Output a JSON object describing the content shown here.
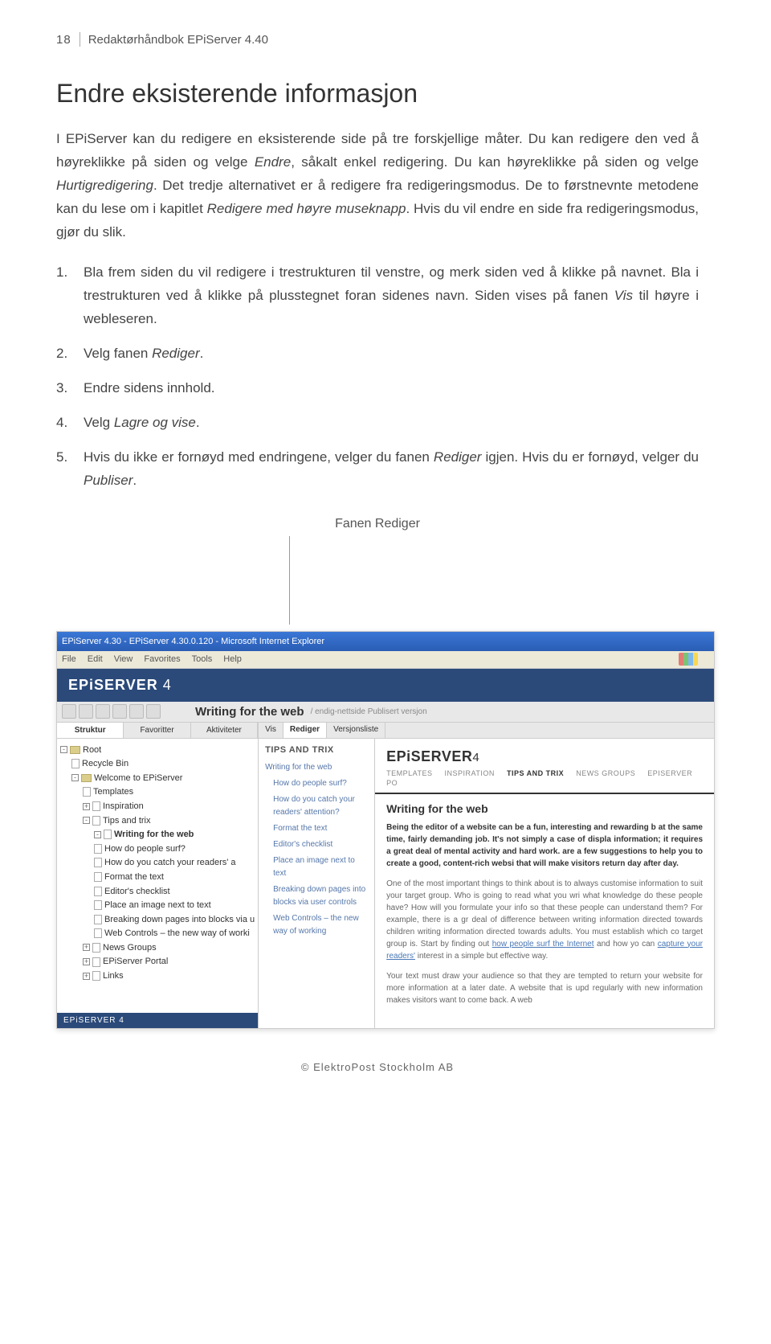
{
  "header": {
    "page_num": "18",
    "title": "Redaktørhåndbok EPiServer 4.40"
  },
  "section_title": "Endre eksisterende informasjon",
  "para1_a": "I EPiServer kan du redigere en eksisterende side på tre forskjellige måter. Du kan redigere den ved å høyreklikke på siden og velge ",
  "para1_b": "Endre",
  "para1_c": ", såkalt enkel redigering. Du kan høyreklikke på siden og velge ",
  "para1_d": "Hurtigredigering",
  "para1_e": ". Det tredje alternativet er å redigere fra redigeringsmodus. De to førstnevnte metodene kan du lese om i kapitlet ",
  "para1_f": "Redigere med høyre museknapp",
  "para1_g": ". Hvis du vil endre en side fra redigeringsmodus, gjør du slik.",
  "steps": [
    {
      "n": "1.",
      "t": "Bla frem siden du vil redigere i trestrukturen til venstre, og merk siden ved å klikke på navnet. Bla i trestrukturen ved å klikke på plusstegnet foran sidenes navn. Siden vises på fanen <em>Vis</em> til høyre i webleseren."
    },
    {
      "n": "2.",
      "t": "Velg fanen <em>Rediger</em>."
    },
    {
      "n": "3.",
      "t": "Endre sidens innhold."
    },
    {
      "n": "4.",
      "t": "Velg <em>Lagre og vise</em>."
    },
    {
      "n": "5.",
      "t": "Hvis du ikke er fornøyd med endringene, velger du fanen <em>Rediger</em> igjen. Hvis du er fornøyd, velger du <em>Publiser</em>."
    }
  ],
  "caption": "Fanen Rediger",
  "shot": {
    "titlebar": "EPiServer 4.30 - EPiServer 4.30.0.120 - Microsoft Internet Explorer",
    "menus": [
      "File",
      "Edit",
      "View",
      "Favorites",
      "Tools",
      "Help"
    ],
    "brand": "EPiSERVER",
    "brand_num": "4",
    "page_title": "Writing for the web",
    "page_sub": "/ endig-nettside  Publisert versjon",
    "ltabs": [
      "Struktur",
      "Favoritter",
      "Aktiviteter"
    ],
    "tree": [
      {
        "lvl": 0,
        "pm": "-",
        "ico": "fld",
        "txt": "Root"
      },
      {
        "lvl": 1,
        "pm": "",
        "ico": "pg",
        "txt": "Recycle Bin"
      },
      {
        "lvl": 1,
        "pm": "-",
        "ico": "fld",
        "txt": "Welcome to EPiServer"
      },
      {
        "lvl": 2,
        "pm": "",
        "ico": "pg",
        "txt": "Templates"
      },
      {
        "lvl": 2,
        "pm": "+",
        "ico": "pg",
        "txt": "Inspiration"
      },
      {
        "lvl": 2,
        "pm": "-",
        "ico": "pg",
        "txt": "Tips and trix"
      },
      {
        "lvl": 3,
        "pm": "-",
        "ico": "pg",
        "txt": "Writing for the web",
        "bold": true
      },
      {
        "lvl": 3,
        "pm": "",
        "ico": "pg",
        "txt": "How do people surf?"
      },
      {
        "lvl": 3,
        "pm": "",
        "ico": "pg",
        "txt": "How do you catch your readers' a"
      },
      {
        "lvl": 3,
        "pm": "",
        "ico": "pg",
        "txt": "Format the text"
      },
      {
        "lvl": 3,
        "pm": "",
        "ico": "pg",
        "txt": "Editor's checklist"
      },
      {
        "lvl": 3,
        "pm": "",
        "ico": "pg",
        "txt": "Place an image next to text"
      },
      {
        "lvl": 3,
        "pm": "",
        "ico": "pg",
        "txt": "Breaking down pages into blocks via u"
      },
      {
        "lvl": 3,
        "pm": "",
        "ico": "pg",
        "txt": "Web Controls – the new way of worki"
      },
      {
        "lvl": 2,
        "pm": "+",
        "ico": "pg",
        "txt": "News Groups"
      },
      {
        "lvl": 2,
        "pm": "+",
        "ico": "pg",
        "txt": "EPiServer Portal"
      },
      {
        "lvl": 2,
        "pm": "+",
        "ico": "pg",
        "txt": "Links"
      }
    ],
    "lfooter": "EPiSERVER 4",
    "rtabs": [
      "Vis",
      "Rediger",
      "Versjonsliste"
    ],
    "mid_head": "TIPS AND TRIX",
    "mid_items": [
      "Writing for the web",
      "How do people surf?",
      "How do you catch your readers' attention?",
      "Format the text",
      "Editor's checklist",
      "Place an image next to text",
      "Breaking down pages into blocks via user controls",
      "Web Controls – the new way of working"
    ],
    "nav2": [
      "TEMPLATES",
      "INSPIRATION",
      "TIPS AND TRIX",
      "NEWS GROUPS",
      "EPISERVER PO"
    ],
    "article": {
      "title": "Writing for the web",
      "p1": "Being the editor of a website can be a fun, interesting and rewarding b at the same time, fairly demanding job. It's not simply a case of displa information; it requires a great deal of mental activity and hard work. are a few suggestions to help you to create a good, content-rich websi that will make visitors return day after day.",
      "p2a": "One of the most important things to think about is to always customise information to suit your target group. Who is going to read what you wri what knowledge do these people have? How will you formulate your info so that these people can understand them? For example, there is a gr deal of difference between writing information directed towards children writing information directed towards adults. You must establish which co target group is. Start by finding out ",
      "p2link": "how people surf the Internet",
      "p2b": " and how yo can ",
      "p2link2": "capture your readers'",
      "p2c": " interest in a simple but effective way.",
      "p3": "Your text must draw your audience so that they are tempted to return your website for more information at a later date. A website that is upd regularly with new information makes visitors want to come back. A web"
    }
  },
  "footer": "© ElektroPost Stockholm AB"
}
